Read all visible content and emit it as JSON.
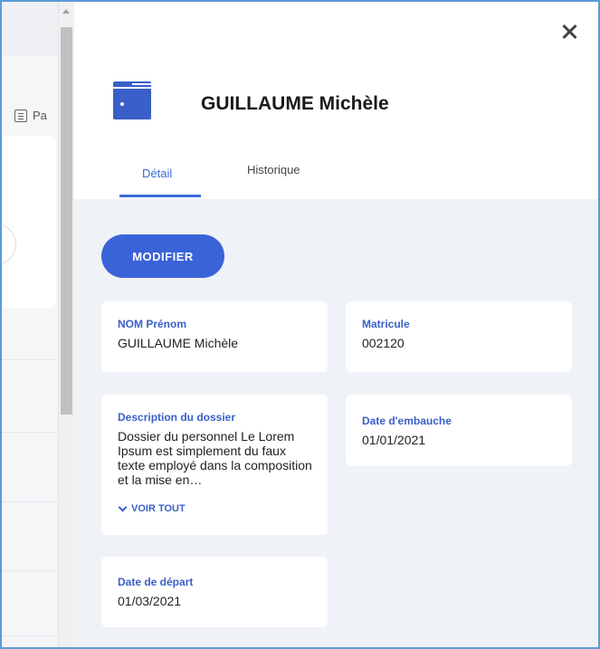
{
  "background": {
    "partial_link_label": "Pa"
  },
  "drawer": {
    "title": "GUILLAUME Michèle",
    "close_icon": "close-icon",
    "header_icon": "folder-icon",
    "tabs": [
      {
        "label": "Détail",
        "active": true
      },
      {
        "label": "Historique",
        "active": false
      }
    ],
    "modify_button_label": "MODIFIER",
    "fields": {
      "nom": {
        "label": "NOM Prénom",
        "value": "GUILLAUME Michèle"
      },
      "matricule": {
        "label": "Matricule",
        "value": "002120"
      },
      "description": {
        "label": "Description du dossier",
        "value": "Dossier du personnel Le Lorem Ipsum est simplement du faux texte employé dans la composition et la mise en…",
        "expand_label": "VOIR TOUT"
      },
      "embauche": {
        "label": "Date d'embauche",
        "value": "01/01/2021"
      },
      "depart": {
        "label": "Date de départ",
        "value": "01/03/2021"
      }
    }
  },
  "colors": {
    "accent": "#3a63d8",
    "label_blue": "#3a5fc8",
    "panel_background": "#eff2f7"
  }
}
